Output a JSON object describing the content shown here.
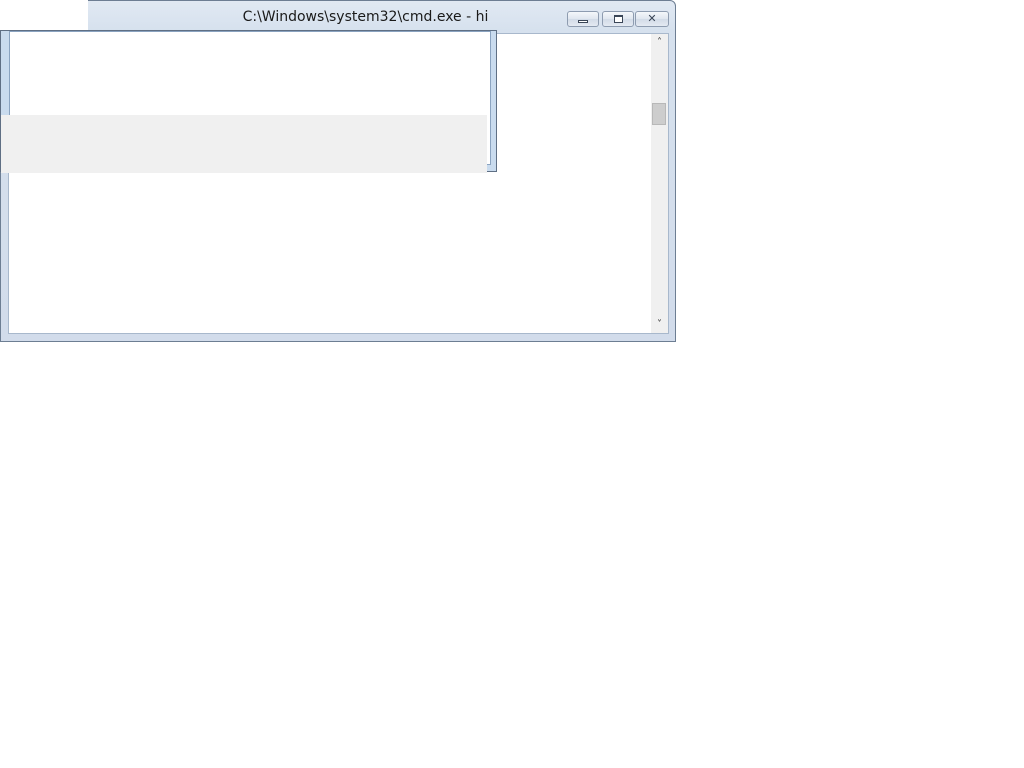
{
  "cmd_window": {
    "title": "C:\\Windows\\system32\\cmd.exe - hi",
    "buttons": {
      "minimize_icon": "minimize-icon",
      "maximize_icon": "maximize-icon",
      "close_icon": "close-icon",
      "close_glyph": "✕"
    },
    "scrollbar": {
      "up_arrow": "˄",
      "down_arrow": "˅",
      "thumb_position": 0.24
    }
  },
  "dialog_window": {
    "title": ""
  },
  "colors": {
    "frame": "#d2dceb",
    "client_background": "#ffffff",
    "dialog_background": "#f0f0f0"
  }
}
